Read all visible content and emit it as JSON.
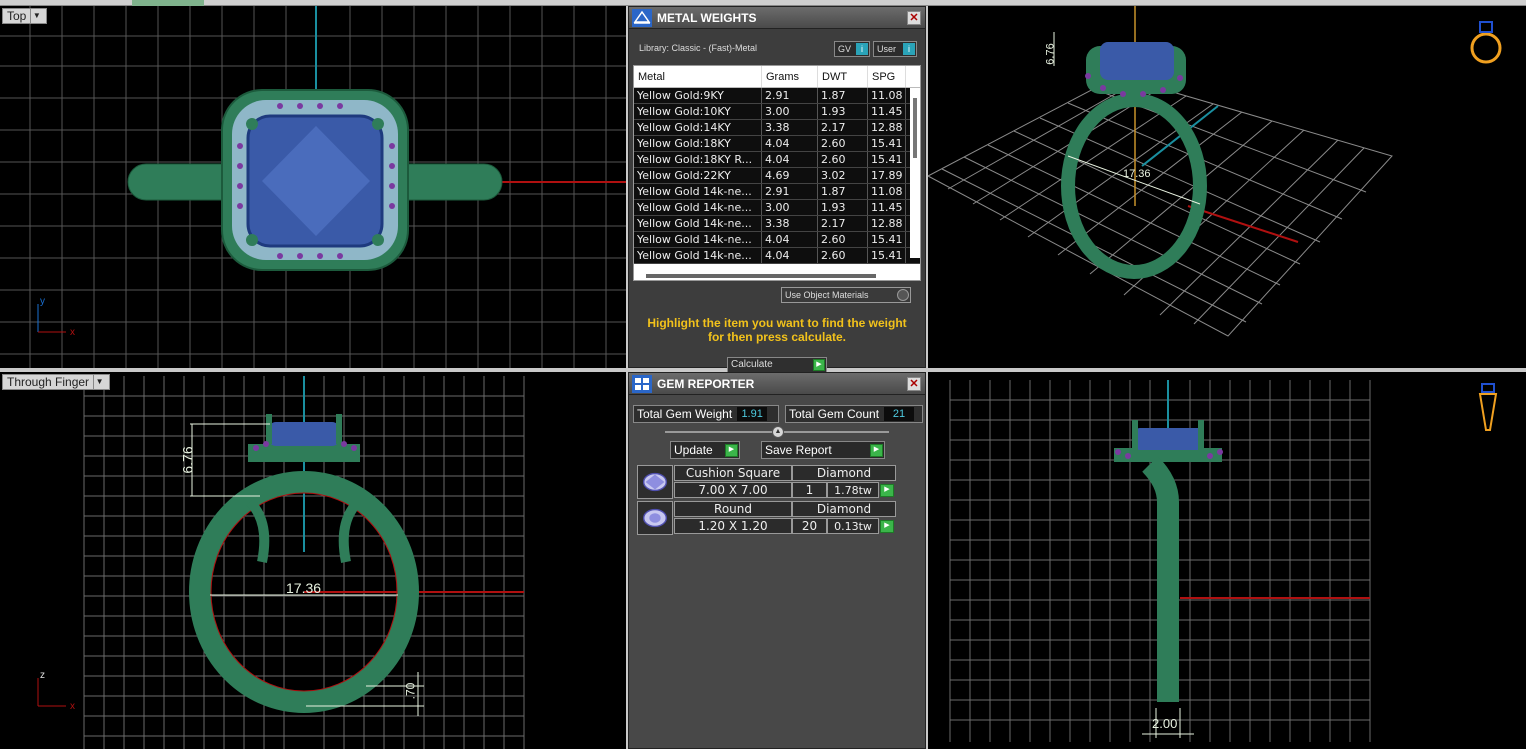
{
  "viewports": {
    "top": {
      "label": "Top"
    },
    "through_finger": {
      "label": "Through Finger"
    },
    "dims": {
      "height": "6.76",
      "inner": "17.36",
      "band": ".70",
      "width": "2.00"
    }
  },
  "metal_weights": {
    "title": "METAL WEIGHTS",
    "library": "Library: Classic - (Fast)-Metal",
    "gv_label": "GV",
    "user_label": "User",
    "columns": [
      "Metal",
      "Grams",
      "DWT",
      "SPG"
    ],
    "rows": [
      [
        "Yellow Gold:9KY",
        "2.91",
        "1.87",
        "11.08"
      ],
      [
        "Yellow Gold:10KY",
        "3.00",
        "1.93",
        "11.45"
      ],
      [
        "Yellow Gold:14KY",
        "3.38",
        "2.17",
        "12.88"
      ],
      [
        "Yellow Gold:18KY",
        "4.04",
        "2.60",
        "15.41"
      ],
      [
        "Yellow Gold:18KY R...",
        "4.04",
        "2.60",
        "15.41"
      ],
      [
        "Yellow Gold:22KY",
        "4.69",
        "3.02",
        "17.89"
      ],
      [
        "Yellow Gold 14k-ne...",
        "2.91",
        "1.87",
        "11.08"
      ],
      [
        "Yellow Gold 14k-ne...",
        "3.00",
        "1.93",
        "11.45"
      ],
      [
        "Yellow Gold 14k-ne...",
        "3.38",
        "2.17",
        "12.88"
      ],
      [
        "Yellow Gold 14k-ne...",
        "4.04",
        "2.60",
        "15.41"
      ],
      [
        "Yellow Gold 14k-ne...",
        "4.04",
        "2.60",
        "15.41"
      ]
    ],
    "use_object_materials": "Use Object Materials",
    "hint": "Highlight the item you want to find the weight for then press calculate.",
    "calculate_label": "Calculate"
  },
  "gem_reporter": {
    "title": "GEM REPORTER",
    "total_weight_label": "Total Gem Weight",
    "total_weight": "1.91",
    "total_count_label": "Total Gem Count",
    "total_count": "21",
    "update_label": "Update",
    "save_label": "Save Report",
    "gems": [
      {
        "shape": "Cushion Square",
        "type": "Diamond",
        "size": "7.00 X 7.00",
        "count": "1",
        "weight": "1.78tw"
      },
      {
        "shape": "Round",
        "type": "Diamond",
        "size": "1.20 X 1.20",
        "count": "20",
        "weight": "0.13tw"
      }
    ]
  },
  "colors": {
    "metal": "#2f7d59",
    "gem": "#3a5aa8",
    "accent_gem": "#7a3aa0",
    "grid": "#6e6e6e",
    "axis_red": "#b01010",
    "axis_cyan": "#1a8fa0",
    "hint": "#f2c21b"
  }
}
